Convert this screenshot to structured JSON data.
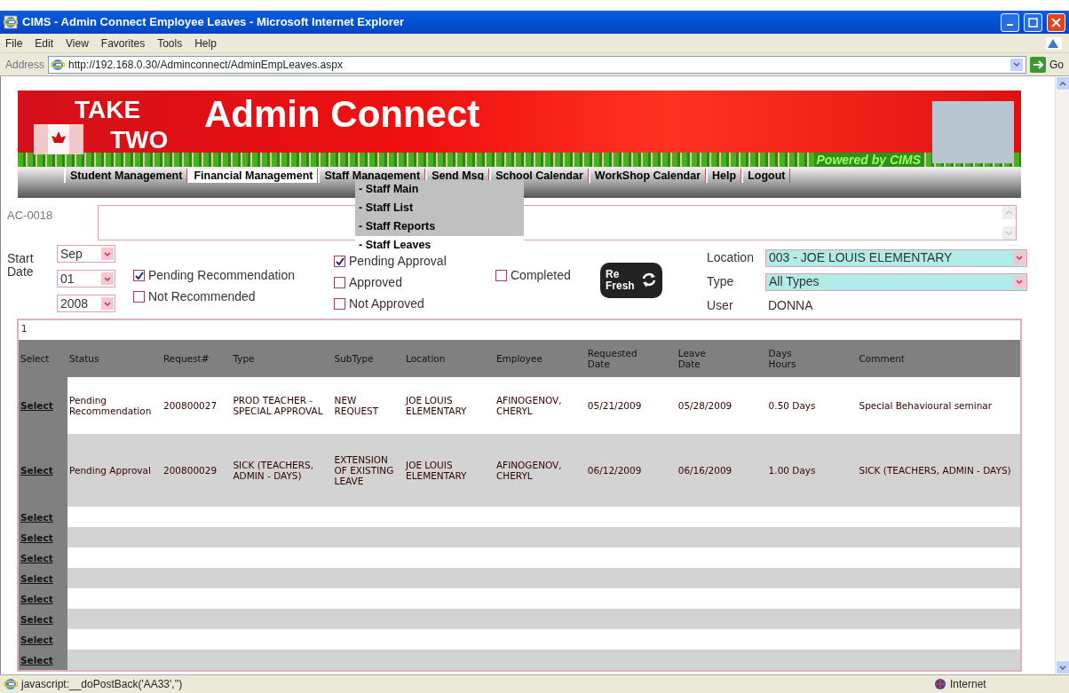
{
  "window": {
    "title": "CIMS - Admin Connect Employee Leaves - Microsoft Internet Explorer"
  },
  "menu_bar": [
    "File",
    "Edit",
    "View",
    "Favorites",
    "Tools",
    "Help"
  ],
  "address_bar": {
    "label": "Address",
    "url": "http://192.168.0.30/Adminconnect/AdminEmpLeaves.aspx",
    "go": "Go"
  },
  "banner": {
    "logo_line_1": "TAKE",
    "logo_line_2": "TWO",
    "title": "Admin Connect",
    "powered_by": "Powered by CIMS"
  },
  "nav": [
    {
      "label": "Student Management",
      "highlighted": false
    },
    {
      "label": "Financial Management",
      "highlighted": true
    },
    {
      "label": "Staff Management",
      "highlighted": false
    },
    {
      "label": "Send Msg",
      "highlighted": false
    },
    {
      "label": "School Calendar",
      "highlighted": false
    },
    {
      "label": "WorkShop Calendar",
      "highlighted": false
    },
    {
      "label": "Help",
      "highlighted": false
    },
    {
      "label": "Logout",
      "highlighted": false
    }
  ],
  "nav_dropdown": [
    {
      "label": "- Staff Main",
      "selected": false
    },
    {
      "label": "- Staff List",
      "selected": false
    },
    {
      "label": "- Staff Reports",
      "selected": false
    },
    {
      "label": "- Staff Leaves",
      "selected": true
    }
  ],
  "record_code": "AC-0018",
  "start_date": {
    "label": "Start Date",
    "month": "Sep",
    "day": "01",
    "year": "2008"
  },
  "filter_columns": [
    [
      {
        "label": "Pending Recommendation",
        "checked": true
      },
      {
        "label": "Not Recommended",
        "checked": false
      }
    ],
    [
      {
        "label": "Pending Approval",
        "checked": true
      },
      {
        "label": "Approved",
        "checked": false
      },
      {
        "label": "Not Approved",
        "checked": false
      }
    ],
    [
      {
        "label": "Completed",
        "checked": false
      }
    ]
  ],
  "refresh_button": {
    "line_1": "Re",
    "line_2": "Fresh"
  },
  "location": {
    "label": "Location",
    "value": "003 - JOE LOUIS ELEMENTARY"
  },
  "type": {
    "label": "Type",
    "value": "All Types"
  },
  "user": {
    "label": "User",
    "value": "DONNA"
  },
  "table": {
    "page": "1",
    "columns": [
      "Select",
      "Status",
      "Request#",
      "Type",
      "SubType",
      "Location",
      "Employee",
      "Requested\nDate",
      "Leave\nDate",
      "Days\nHours",
      "Comment"
    ],
    "rows": [
      [
        "Select",
        "Pending Recommendation",
        "200800027",
        "PROD TEACHER - SPECIAL APPROVAL",
        "NEW REQUEST",
        "JOE LOUIS ELEMENTARY",
        "AFINOGENOV, CHERYL",
        "05/21/2009",
        "05/28/2009",
        "0.50 Days",
        "Special Behavioural seminar"
      ],
      [
        "Select",
        "Pending Approval",
        "200800029",
        "SICK (TEACHERS, ADMIN - DAYS)",
        "EXTENSION OF EXISTING LEAVE",
        "JOE LOUIS ELEMENTARY",
        "AFINOGENOV, CHERYL",
        "06/12/2009",
        "06/16/2009",
        "1.00 Days",
        "SICK (TEACHERS, ADMIN - DAYS)"
      ]
    ],
    "empty_rows": [
      "Select",
      "Select",
      "Select",
      "Select",
      "Select",
      "Select",
      "Select",
      "Select"
    ]
  },
  "status_bar": {
    "text": "javascript:__doPostBack('AA33','')",
    "zone": "Internet"
  }
}
